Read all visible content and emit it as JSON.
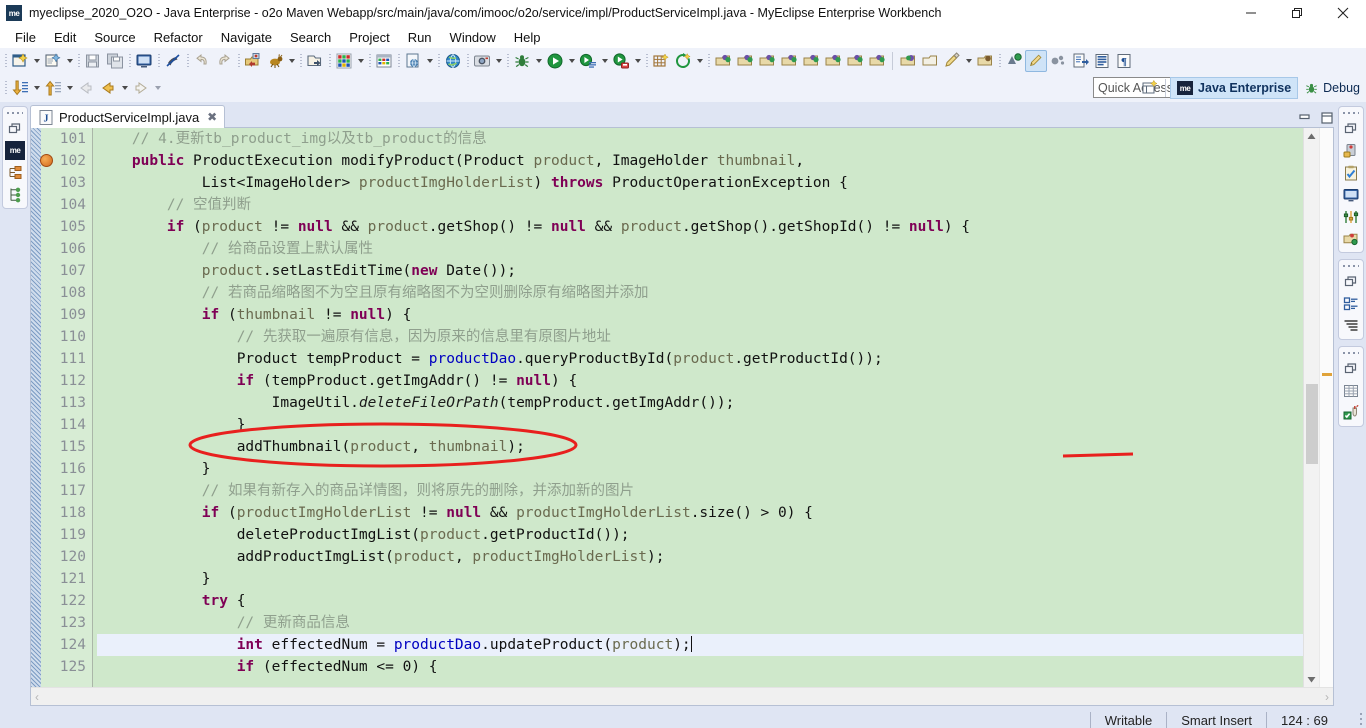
{
  "window": {
    "app_icon": "me",
    "title": "myeclipse_2020_O2O - Java Enterprise - o2o Maven Webapp/src/main/java/com/imooc/o2o/service/impl/ProductServiceImpl.java - MyEclipse Enterprise Workbench",
    "minimize": "─",
    "maximize": "❐",
    "close": "✕"
  },
  "menu": {
    "items": [
      "File",
      "Edit",
      "Source",
      "Refactor",
      "Navigate",
      "Search",
      "Project",
      "Run",
      "Window",
      "Help"
    ]
  },
  "toolbar": {
    "quick_access_placeholder": "Quick Access",
    "perspectives": [
      {
        "label": "Java Enterprise",
        "icon": "me-icon",
        "active": true
      },
      {
        "label": "Debug",
        "icon": "debug-bug-icon",
        "active": false
      }
    ]
  },
  "left_side_bar": {
    "stacks": [
      {
        "icons": [
          "restore-icon",
          "myeclipse-explorer-icon",
          "package-explorer-icon",
          "type-hierarchy-icon"
        ]
      }
    ]
  },
  "right_side_bar": {
    "stacks": [
      {
        "icons": [
          "restore-icon",
          "servers-icon",
          "tasks-icon",
          "console-icon",
          "properties-icon",
          "project-explorer-icon"
        ]
      },
      {
        "icons": [
          "restore-icon",
          "outline-icon",
          "task-list-icon"
        ]
      },
      {
        "icons": [
          "restore-icon",
          "table-icon",
          "junit-icon"
        ]
      }
    ]
  },
  "editor": {
    "tab": {
      "label": "ProductServiceImpl.java",
      "icon": "java-file-icon",
      "close": "✖"
    },
    "controls": [
      "minimize-editor-icon",
      "maximize-editor-icon"
    ],
    "first_line": 101,
    "current_line": 124,
    "breakpoint_line": 102,
    "lines": [
      {
        "n": 101,
        "indent": 1,
        "tokens": [
          {
            "t": "// 4.更新tb_product_img以及tb_product的信息",
            "c": "cmt"
          }
        ]
      },
      {
        "n": 102,
        "indent": 1,
        "tokens": [
          {
            "t": "public ",
            "c": "kw"
          },
          {
            "t": "ProductExecution modifyProduct(Product ",
            "c": "pl"
          },
          {
            "t": "product",
            "c": "par"
          },
          {
            "t": ", ImageHolder ",
            "c": "pl"
          },
          {
            "t": "thumbnail",
            "c": "par"
          },
          {
            "t": ",",
            "c": "pl"
          }
        ]
      },
      {
        "n": 103,
        "indent": 3,
        "tokens": [
          {
            "t": "List<ImageHolder> ",
            "c": "pl"
          },
          {
            "t": "productImgHolderList",
            "c": "par"
          },
          {
            "t": ") ",
            "c": "pl"
          },
          {
            "t": "throws ",
            "c": "kw"
          },
          {
            "t": "ProductOperationException {",
            "c": "pl"
          }
        ]
      },
      {
        "n": 104,
        "indent": 2,
        "tokens": [
          {
            "t": "// 空值判断",
            "c": "cmt"
          }
        ]
      },
      {
        "n": 105,
        "indent": 2,
        "tokens": [
          {
            "t": "if ",
            "c": "kw"
          },
          {
            "t": "(",
            "c": "pl"
          },
          {
            "t": "product",
            "c": "par"
          },
          {
            "t": " != ",
            "c": "pl"
          },
          {
            "t": "null",
            "c": "kw"
          },
          {
            "t": " && ",
            "c": "pl"
          },
          {
            "t": "product",
            "c": "par"
          },
          {
            "t": ".getShop() != ",
            "c": "pl"
          },
          {
            "t": "null",
            "c": "kw"
          },
          {
            "t": " && ",
            "c": "pl"
          },
          {
            "t": "product",
            "c": "par"
          },
          {
            "t": ".getShop().getShopId() != ",
            "c": "pl"
          },
          {
            "t": "null",
            "c": "kw"
          },
          {
            "t": ") {",
            "c": "pl"
          }
        ]
      },
      {
        "n": 106,
        "indent": 3,
        "tokens": [
          {
            "t": "// 给商品设置上默认属性",
            "c": "cmt"
          }
        ]
      },
      {
        "n": 107,
        "indent": 3,
        "tokens": [
          {
            "t": "product",
            "c": "par"
          },
          {
            "t": ".setLastEditTime(",
            "c": "pl"
          },
          {
            "t": "new ",
            "c": "kw"
          },
          {
            "t": "Date());",
            "c": "pl"
          }
        ]
      },
      {
        "n": 108,
        "indent": 3,
        "tokens": [
          {
            "t": "// 若商品缩略图不为空且原有缩略图不为空则删除原有缩略图并添加",
            "c": "cmt"
          }
        ]
      },
      {
        "n": 109,
        "indent": 3,
        "tokens": [
          {
            "t": "if ",
            "c": "kw"
          },
          {
            "t": "(",
            "c": "pl"
          },
          {
            "t": "thumbnail",
            "c": "par"
          },
          {
            "t": " != ",
            "c": "pl"
          },
          {
            "t": "null",
            "c": "kw"
          },
          {
            "t": ") {",
            "c": "pl"
          }
        ]
      },
      {
        "n": 110,
        "indent": 4,
        "tokens": [
          {
            "t": "// 先获取一遍原有信息，因为原来的信息里有原图片地址",
            "c": "cmt"
          }
        ]
      },
      {
        "n": 111,
        "indent": 4,
        "tokens": [
          {
            "t": "Product tempProduct = ",
            "c": "pl"
          },
          {
            "t": "productDao",
            "c": "fld"
          },
          {
            "t": ".queryProductById(",
            "c": "pl"
          },
          {
            "t": "product",
            "c": "par"
          },
          {
            "t": ".getProductId());",
            "c": "pl"
          }
        ]
      },
      {
        "n": 112,
        "indent": 4,
        "tokens": [
          {
            "t": "if ",
            "c": "kw"
          },
          {
            "t": "(tempProduct.getImgAddr() != ",
            "c": "pl"
          },
          {
            "t": "null",
            "c": "kw"
          },
          {
            "t": ") {",
            "c": "pl"
          }
        ]
      },
      {
        "n": 113,
        "indent": 5,
        "tokens": [
          {
            "t": "ImageUtil.",
            "c": "pl"
          },
          {
            "t": "deleteFileOrPath",
            "c": "it"
          },
          {
            "t": "(tempProduct.getImgAddr());",
            "c": "pl"
          }
        ]
      },
      {
        "n": 114,
        "indent": 4,
        "tokens": [
          {
            "t": "}",
            "c": "pl"
          }
        ]
      },
      {
        "n": 115,
        "indent": 4,
        "tokens": [
          {
            "t": "addThumbnail(",
            "c": "pl"
          },
          {
            "t": "product",
            "c": "par"
          },
          {
            "t": ", ",
            "c": "pl"
          },
          {
            "t": "thumbnail",
            "c": "par"
          },
          {
            "t": ");",
            "c": "pl"
          }
        ]
      },
      {
        "n": 116,
        "indent": 3,
        "tokens": [
          {
            "t": "}",
            "c": "pl"
          }
        ]
      },
      {
        "n": 117,
        "indent": 3,
        "tokens": [
          {
            "t": "// 如果有新存入的商品详情图，则将原先的删除，并添加新的图片",
            "c": "cmt"
          }
        ]
      },
      {
        "n": 118,
        "indent": 3,
        "tokens": [
          {
            "t": "if ",
            "c": "kw"
          },
          {
            "t": "(",
            "c": "pl"
          },
          {
            "t": "productImgHolderList",
            "c": "par"
          },
          {
            "t": " != ",
            "c": "pl"
          },
          {
            "t": "null",
            "c": "kw"
          },
          {
            "t": " && ",
            "c": "pl"
          },
          {
            "t": "productImgHolderList",
            "c": "par"
          },
          {
            "t": ".size() > 0) {",
            "c": "pl"
          }
        ]
      },
      {
        "n": 119,
        "indent": 4,
        "tokens": [
          {
            "t": "deleteProductImgList(",
            "c": "pl"
          },
          {
            "t": "product",
            "c": "par"
          },
          {
            "t": ".getProductId());",
            "c": "pl"
          }
        ]
      },
      {
        "n": 120,
        "indent": 4,
        "tokens": [
          {
            "t": "addProductImgList(",
            "c": "pl"
          },
          {
            "t": "product",
            "c": "par"
          },
          {
            "t": ", ",
            "c": "pl"
          },
          {
            "t": "productImgHolderList",
            "c": "par"
          },
          {
            "t": ");",
            "c": "pl"
          }
        ]
      },
      {
        "n": 121,
        "indent": 3,
        "tokens": [
          {
            "t": "}",
            "c": "pl"
          }
        ]
      },
      {
        "n": 122,
        "indent": 3,
        "tokens": [
          {
            "t": "try ",
            "c": "kw"
          },
          {
            "t": "{",
            "c": "pl"
          }
        ]
      },
      {
        "n": 123,
        "indent": 4,
        "tokens": [
          {
            "t": "// 更新商品信息",
            "c": "cmt"
          }
        ]
      },
      {
        "n": 124,
        "indent": 4,
        "tokens": [
          {
            "t": "int ",
            "c": "kw"
          },
          {
            "t": "effectedNum = ",
            "c": "pl"
          },
          {
            "t": "productDao",
            "c": "fld"
          },
          {
            "t": ".updateProduct(",
            "c": "pl"
          },
          {
            "t": "product",
            "c": "par"
          },
          {
            "t": ");",
            "c": "pl"
          }
        ],
        "current": true
      },
      {
        "n": 125,
        "indent": 4,
        "tokens": [
          {
            "t": "if ",
            "c": "kw"
          },
          {
            "t": "(effectedNum <= ",
            "c": "pl"
          },
          {
            "t": "0",
            "c": "pl"
          },
          {
            "t": ") {",
            "c": "pl"
          }
        ]
      }
    ],
    "annotations": {
      "circle_label": "red-ellipse-around-addThumbnail",
      "underline_label": "red-underline-mark"
    },
    "hscroll": {
      "left_arrow": "‹",
      "right_arrow": "›"
    }
  },
  "statusbar": {
    "writable": "Writable",
    "insert_mode": "Smart Insert",
    "position": "124 : 69"
  },
  "colors": {
    "code_background": "#cfe8cb",
    "gutter_background": "#d7ecd4",
    "current_line": "#eaf0fb",
    "keyword": "#7f0055",
    "comment": "#8f9f8d",
    "field": "#0000c0",
    "parameter": "#6a6a4f",
    "annotation_red": "#e8201e",
    "chrome": "#dfe5f3",
    "accent_blue": "#cfe4f8"
  }
}
